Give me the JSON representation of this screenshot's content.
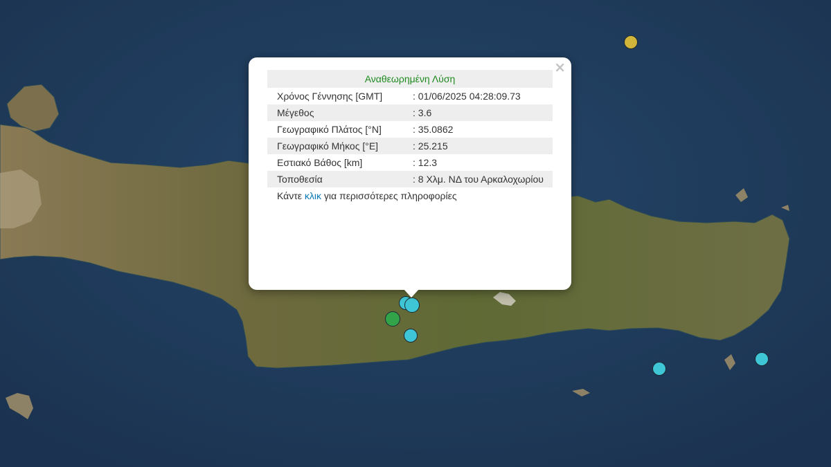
{
  "popup": {
    "heading": "Αναθεωρημένη Λύση",
    "close_symbol": "×",
    "rows": [
      {
        "label": "Χρόνος Γέννησης [GMT]",
        "value": ": 01/06/2025 04:28:09.73"
      },
      {
        "label": "Μέγεθος",
        "value": ": 3.6"
      },
      {
        "label": "Γεωγραφικό Πλάτος [°N]",
        "value": ": 35.0862"
      },
      {
        "label": "Γεωγραφικό Μήκος [°E]",
        "value": ": 25.215"
      },
      {
        "label": "Εστιακό Βάθος [km]",
        "value": ": 12.3"
      },
      {
        "label": "Τοποθεσία",
        "value": ": 8 Χλμ. ΝΔ του Αρκαλοχωρίου"
      }
    ],
    "more_prefix": "Κάντε ",
    "more_link": "κλικ",
    "more_suffix": " για περισσότερες πληροφορίες"
  },
  "markers": [
    {
      "name": "marker-yellow-north",
      "color": "#d1b43a"
    },
    {
      "name": "marker-cyan-selected",
      "color": "#3fc6d6"
    },
    {
      "name": "marker-cyan-selected-2",
      "color": "#3fc6d6"
    },
    {
      "name": "marker-green",
      "color": "#33a34a"
    },
    {
      "name": "marker-cyan-south",
      "color": "#3fc6d6"
    },
    {
      "name": "marker-cyan-southeast-1",
      "color": "#3fc6d6"
    },
    {
      "name": "marker-cyan-southeast-2",
      "color": "#3fc6d6"
    }
  ],
  "colors": {
    "sea": "#1f3a55",
    "land": "#6b6c3e",
    "heading_text": "#1f8a1f",
    "link": "#0a78b5"
  }
}
